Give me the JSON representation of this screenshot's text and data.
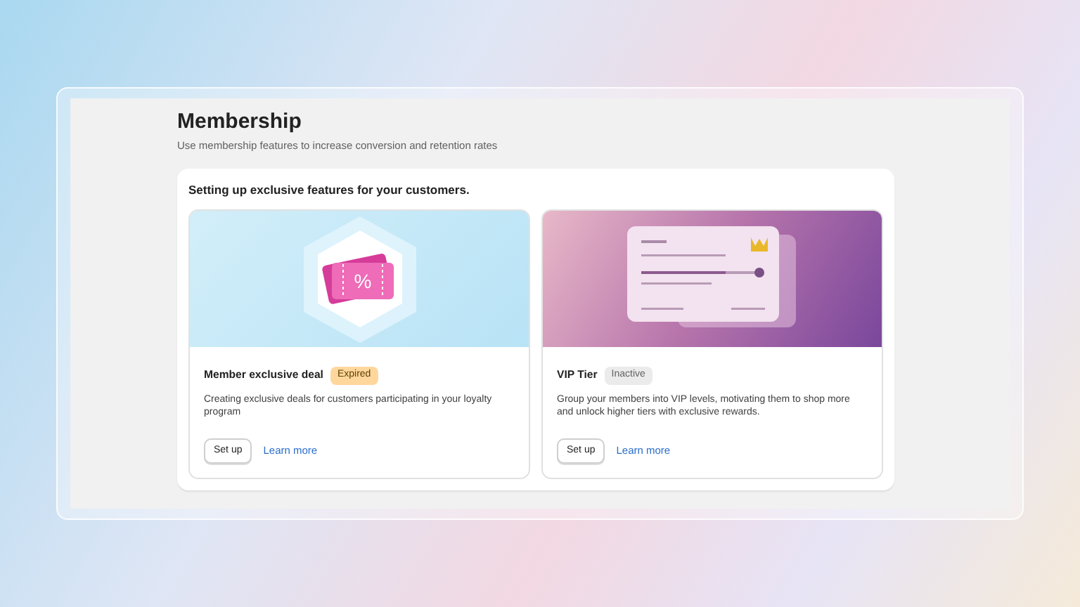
{
  "page": {
    "title": "Membership",
    "subtitle": "Use membership features to increase conversion and retention rates"
  },
  "section": {
    "heading": "Setting up exclusive features for your customers.",
    "features": [
      {
        "kind": "deal",
        "title": "Member exclusive deal",
        "status": {
          "kind": "expired",
          "label": "Expired"
        },
        "description": "Creating exclusive deals for customers participating in your loyalty program",
        "icon_text": "%",
        "setup": "Set up",
        "learn": "Learn more"
      },
      {
        "kind": "vip",
        "title": "VIP Tier",
        "status": {
          "kind": "inactive",
          "label": "Inactive"
        },
        "description": "Group your members into VIP levels, motivating them to shop more and unlock higher tiers with exclusive rewards.",
        "setup": "Set up",
        "learn": "Learn more"
      }
    ]
  }
}
